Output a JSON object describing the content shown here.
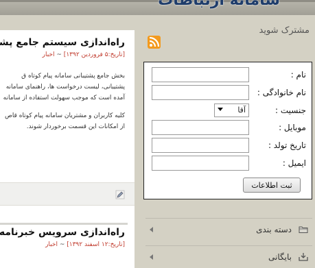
{
  "header": {
    "site_title": "سامانه ارتباطات"
  },
  "posts": [
    {
      "title": "راه‌اندازی سیستم جامع پشتیبانی",
      "date": "[تاریخ:۵ فروردین ۱۳۹۲]",
      "separator": "~",
      "category": "اخبار",
      "paragraphs": [
        "بخش جامع پشتیبانی سامانه پیام کوتاه ق",
        "پشتیبانی، لیست درخواست ها، راهنمای سامانه",
        "آمده است که موجب سهولت استفاده از سامانه",
        "کلیه کاربران و مشتریان سامانه پیام کوتاه قاص",
        "از امکانات این قسمت برخوردار شوند."
      ]
    },
    {
      "title": "راه‌اندازی سرویس خبرنامه پیام",
      "date": "[تاریخ:۱۲ اسفند ۱۳۹۲]",
      "separator": "~",
      "category": "اخبار"
    }
  ],
  "sidebar": {
    "subscribe_title": "مشترک شوید",
    "form": {
      "fields": [
        {
          "label": "نام :",
          "value": ""
        },
        {
          "label": "نام خانوادگی :",
          "value": ""
        },
        {
          "label": "جنسیت :",
          "selected": "آقا"
        },
        {
          "label": "موبایل :",
          "value": ""
        },
        {
          "label": "تاریخ تولد :",
          "value": ""
        },
        {
          "label": "ایمیل :",
          "value": ""
        }
      ],
      "submit_label": "ثبت اطلاعات"
    },
    "widgets": [
      {
        "label": "دسته بندی",
        "icon": "folder-icon"
      },
      {
        "label": "بایگانی",
        "icon": "archive-icon"
      }
    ]
  },
  "colors": {
    "background": "#d4d1c4",
    "meta_red": "#c0392b",
    "rss_orange": "#f39a1e",
    "title_blue": "#1f3d6b"
  }
}
